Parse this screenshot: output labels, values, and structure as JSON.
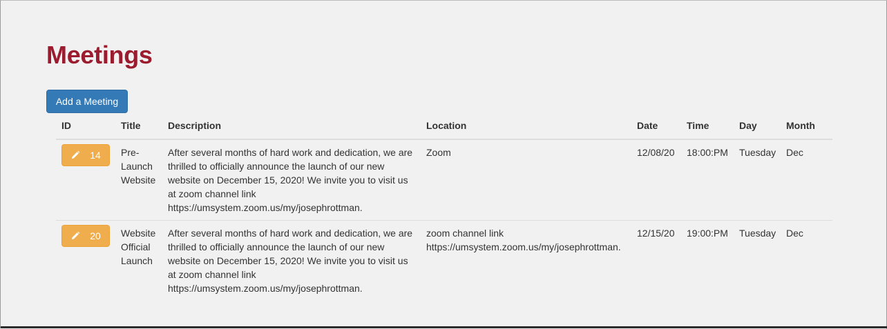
{
  "page": {
    "title": "Meetings",
    "add_button_label": "Add a Meeting"
  },
  "colors": {
    "title": "#9b1c2e",
    "primary_button": "#337ab7",
    "edit_button": "#f0ad4e",
    "background": "#f1f1f1"
  },
  "table": {
    "headers": {
      "id": "ID",
      "title": "Title",
      "description": "Description",
      "location": "Location",
      "date": "Date",
      "time": "Time",
      "day": "Day",
      "month": "Month"
    },
    "rows": [
      {
        "id": "14",
        "edit_icon": "pencil-icon",
        "title": "Pre-Launch Website",
        "description": "After several months of hard work and dedication, we are thrilled to officially announce the launch of our new website on December 15, 2020! We invite you to visit us at zoom channel link https://umsystem.zoom.us/my/josephrottman.",
        "location": "Zoom",
        "date": "12/08/20",
        "time": "18:00:PM",
        "day": "Tuesday",
        "month": "Dec"
      },
      {
        "id": "20",
        "edit_icon": "pencil-icon",
        "title": "Website Official Launch",
        "description": "After several months of hard work and dedication, we are thrilled to officially announce the launch of our new website on December 15, 2020! We invite you to visit us at zoom channel link https://umsystem.zoom.us/my/josephrottman.",
        "location": "zoom channel link https://umsystem.zoom.us/my/josephrottman.",
        "date": "12/15/20",
        "time": "19:00:PM",
        "day": "Tuesday",
        "month": "Dec"
      }
    ]
  }
}
